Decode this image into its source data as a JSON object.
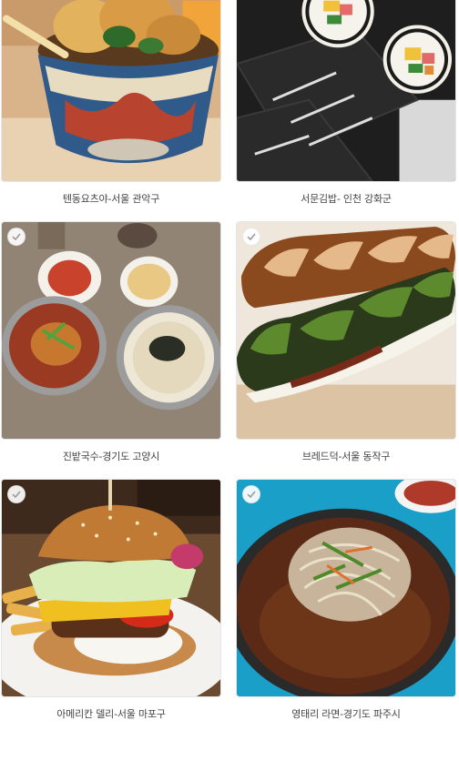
{
  "items": [
    {
      "caption": "텐동요츠야-서울 관악구",
      "image": "tempura-rice-bowl-photo",
      "has_check": false
    },
    {
      "caption": "서문김밥- 인천 강화군",
      "image": "kimbap-rolls-photo",
      "has_check": false
    },
    {
      "caption": "진밭국수-경기도 고양시",
      "image": "noodle-soup-table-photo",
      "has_check": true
    },
    {
      "caption": "브레드덕-서울 동작구",
      "image": "stuffed-bread-loaves-photo",
      "has_check": true
    },
    {
      "caption": "아메리칸 델리-서울 마포구",
      "image": "hamburger-plate-photo",
      "has_check": true
    },
    {
      "caption": "영태리 라면-경기도 파주시",
      "image": "spicy-ramen-bowl-photo",
      "has_check": true
    }
  ],
  "icons": {
    "check": "checkmark-icon"
  },
  "colors": {
    "caption_text": "#444444",
    "card_border": "#e6e6e6"
  }
}
